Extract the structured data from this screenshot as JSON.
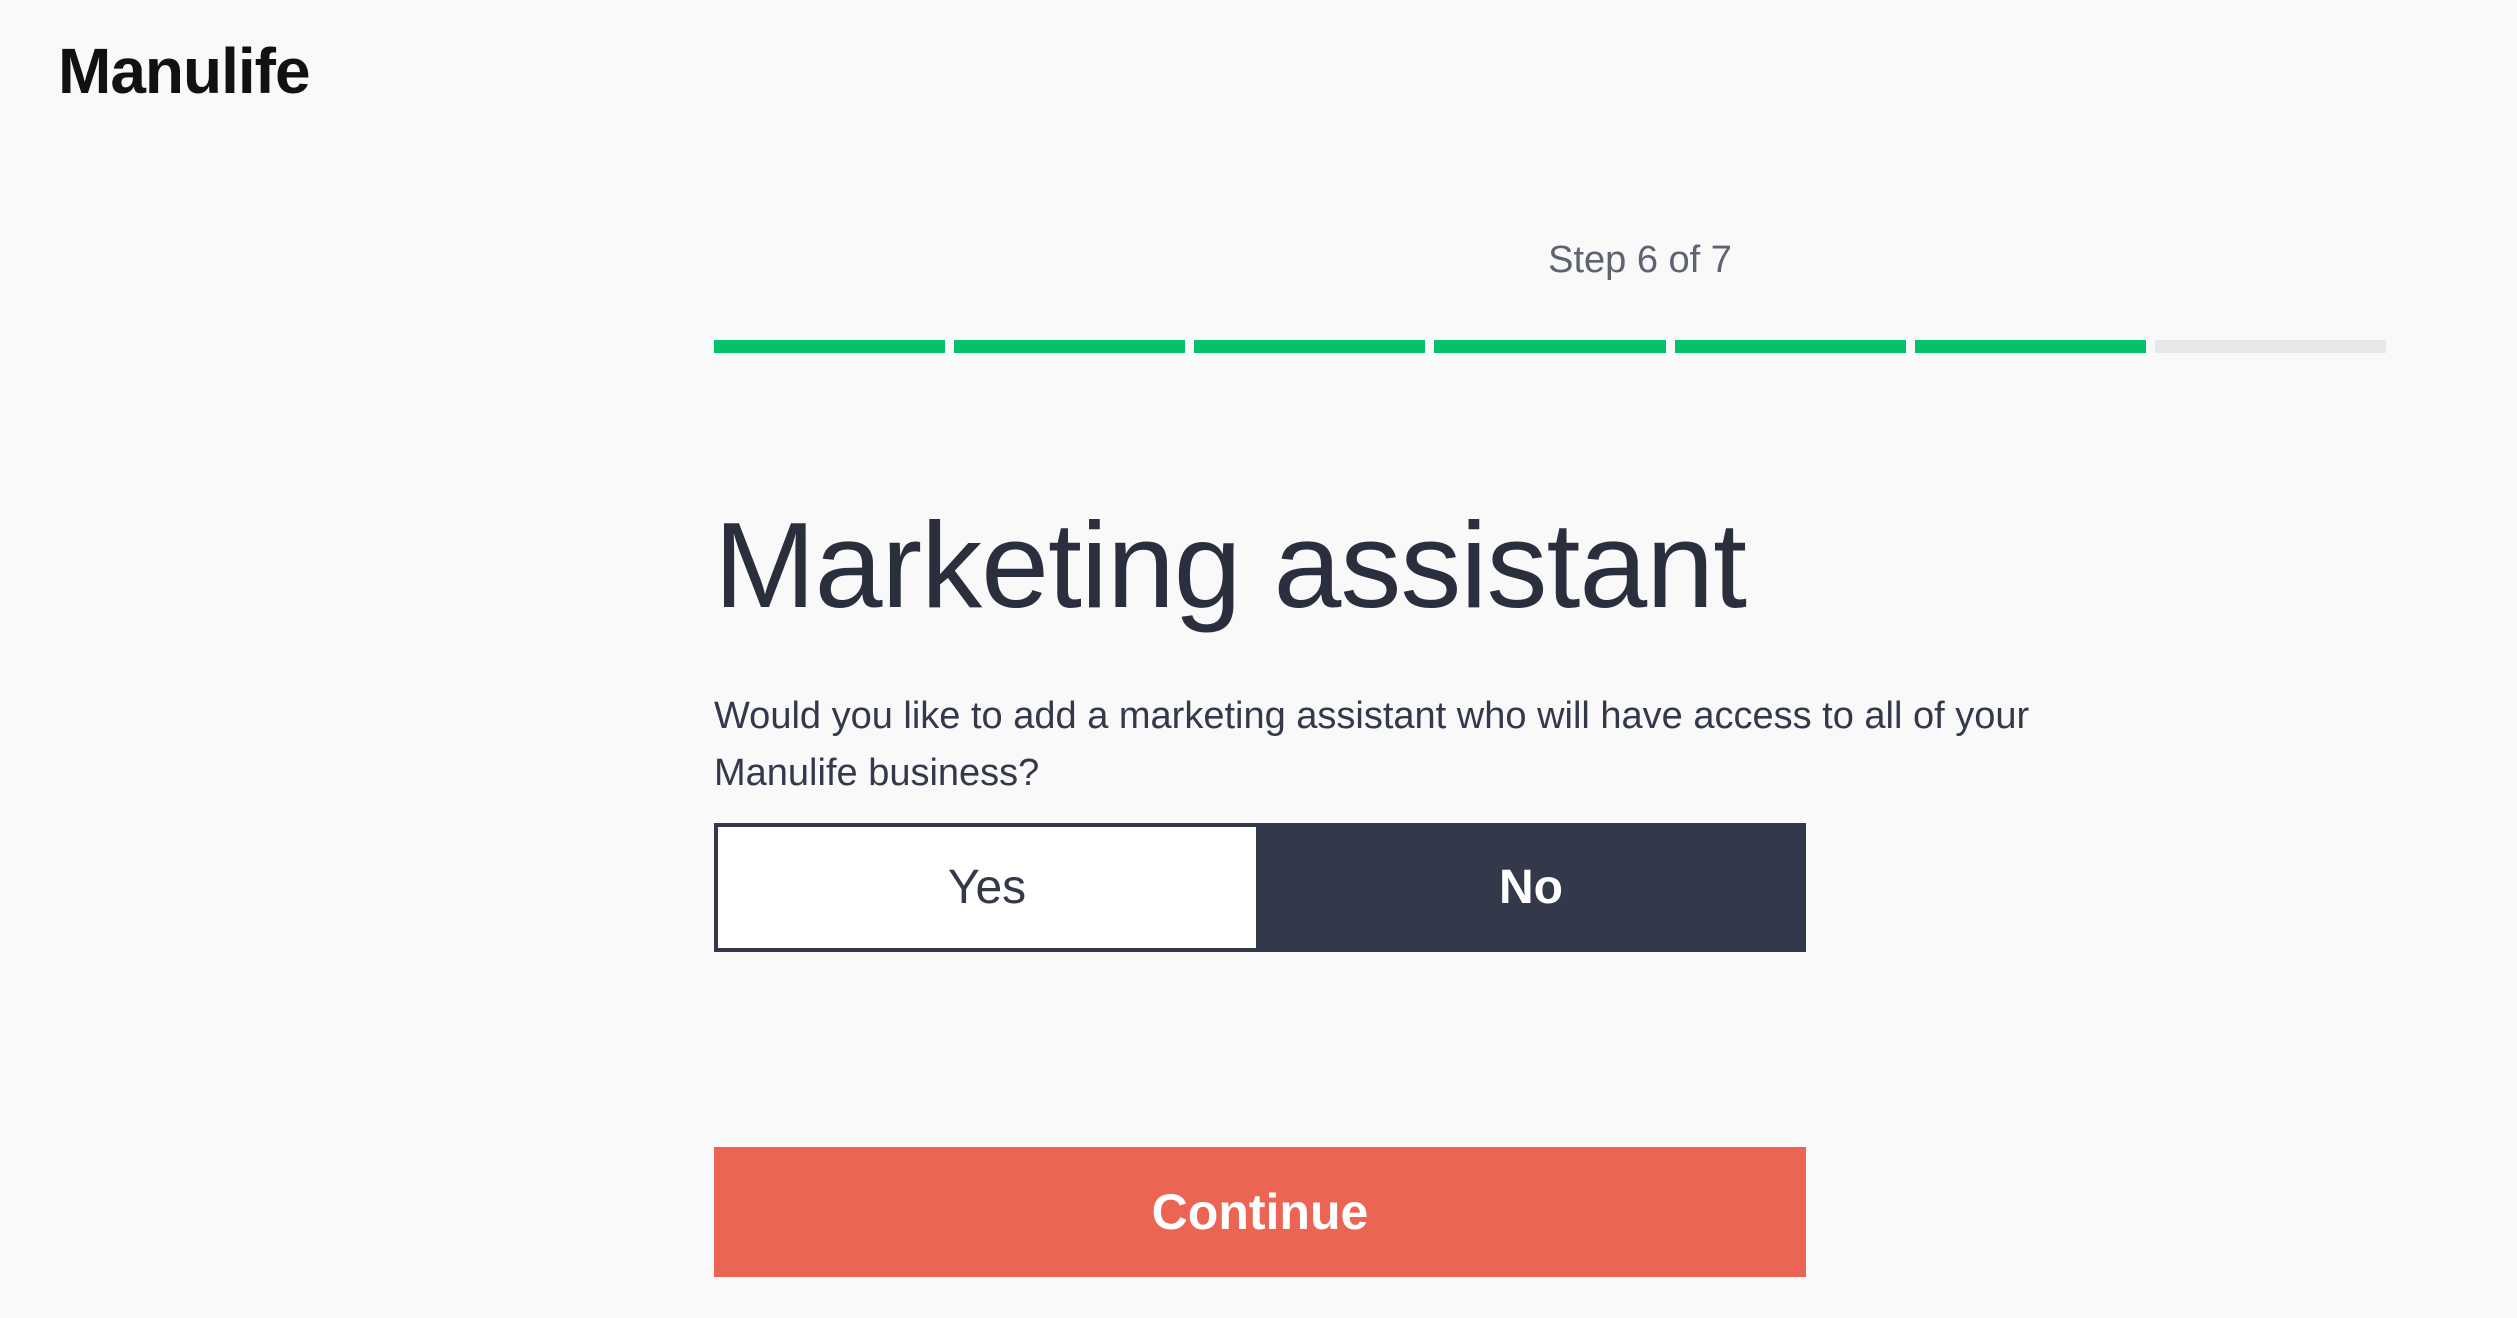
{
  "brand": {
    "logo_text": "Manulife"
  },
  "progress": {
    "label": "Step 6 of 7",
    "current_step": 6,
    "total_steps": 7,
    "active_color": "#06c16b",
    "inactive_color": "#e8e8e8"
  },
  "main": {
    "title": "Marketing assistant",
    "question": "Would you like to add a marketing assistant who will have access to all of your Manulife business?",
    "options": [
      {
        "label": "Yes",
        "selected": false
      },
      {
        "label": "No",
        "selected": true
      }
    ],
    "continue_label": "Continue"
  },
  "colors": {
    "primary_dark": "#34384b",
    "cta": "#ec6453",
    "background": "#f9f9f9"
  }
}
